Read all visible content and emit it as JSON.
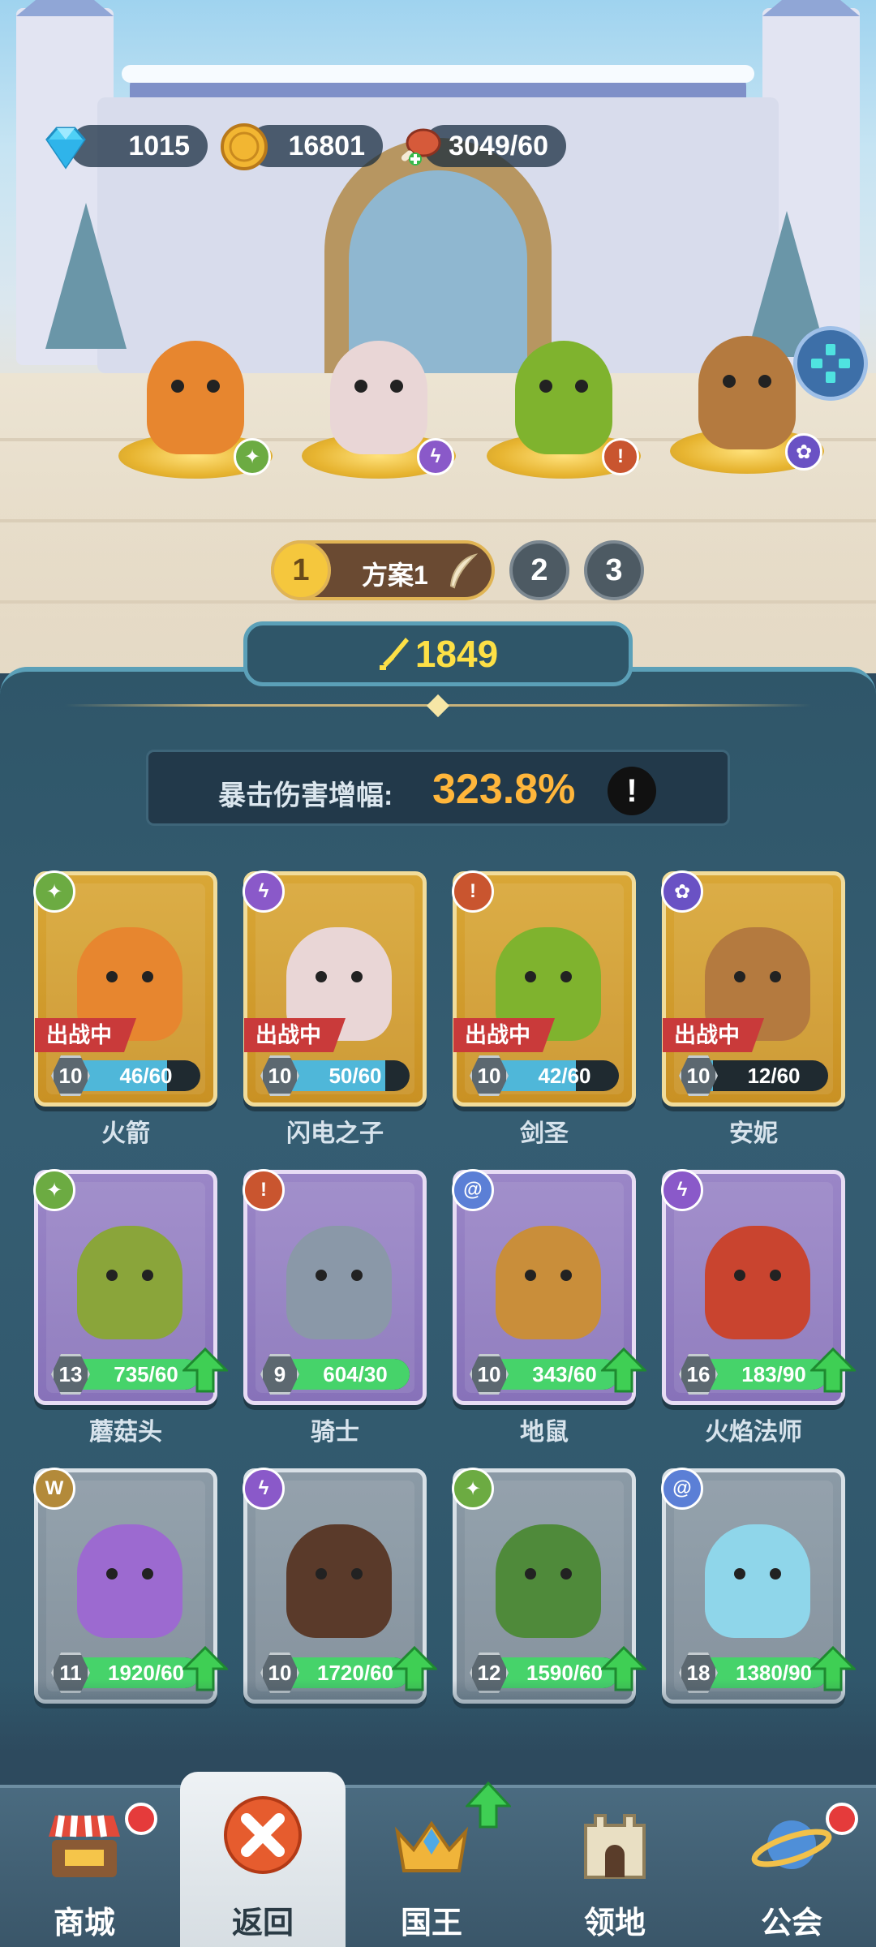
{
  "currency": {
    "gems": "1015",
    "coins": "16801",
    "stamina": "3049/60"
  },
  "icons": {
    "gem": "diamond-icon",
    "coin": "gold-coin-icon",
    "stamina": "meat-icon",
    "gamepad": "gamepad-icon",
    "power": "sword-icon"
  },
  "stage_heroes": [
    {
      "name": "火箭",
      "class_color": "#6cab42"
    },
    {
      "name": "闪电之子",
      "class_color": "#8a59c9"
    },
    {
      "name": "剑圣",
      "class_color": "#c9552f"
    },
    {
      "name": "安妮",
      "class_color": "#6a52c4"
    }
  ],
  "plans": {
    "active_number": "1",
    "active_label": "方案1",
    "others": [
      "2",
      "3"
    ]
  },
  "power": "1849",
  "crit": {
    "label": "暴击伤害增幅:",
    "value": "323.8%",
    "info": "!"
  },
  "heroes": [
    {
      "name": "火箭",
      "level": "10",
      "progress": "46/60",
      "fill": 0.77,
      "tag": "出战中",
      "rarity": "gold",
      "class_icon": "ranger-icon",
      "badge_color": "#6cab42"
    },
    {
      "name": "闪电之子",
      "level": "10",
      "progress": "50/60",
      "fill": 0.83,
      "tag": "出战中",
      "rarity": "gold",
      "class_icon": "mage-icon",
      "badge_color": "#8a59c9"
    },
    {
      "name": "剑圣",
      "level": "10",
      "progress": "42/60",
      "fill": 0.7,
      "tag": "出战中",
      "rarity": "gold",
      "class_icon": "warrior-icon",
      "badge_color": "#c9552f"
    },
    {
      "name": "安妮",
      "level": "10",
      "progress": "12/60",
      "fill": 0.2,
      "tag": "出战中",
      "rarity": "gold",
      "class_icon": "paw-icon",
      "badge_color": "#6a52c4"
    },
    {
      "name": "蘑菇头",
      "level": "13",
      "progress": "735/60",
      "fill": 1,
      "tag": "",
      "rarity": "purple",
      "class_icon": "ranger-icon",
      "badge_color": "#6cab42",
      "upgrade": true
    },
    {
      "name": "骑士",
      "level": "9",
      "progress": "604/30",
      "fill": 1,
      "tag": "",
      "rarity": "purple",
      "class_icon": "warrior-icon",
      "badge_color": "#c9552f",
      "upgrade": false
    },
    {
      "name": "地鼠",
      "level": "10",
      "progress": "343/60",
      "fill": 1,
      "tag": "",
      "rarity": "purple",
      "class_icon": "spiral-icon",
      "badge_color": "#5b7fd6",
      "upgrade": true
    },
    {
      "name": "火焰法师",
      "level": "16",
      "progress": "183/90",
      "fill": 1,
      "tag": "",
      "rarity": "purple",
      "class_icon": "mage-icon",
      "badge_color": "#8a59c9",
      "upgrade": true
    },
    {
      "name": "",
      "level": "11",
      "progress": "1920/60",
      "fill": 1,
      "tag": "",
      "rarity": "gray",
      "class_icon": "wings-icon",
      "badge_color": "#b38a3a",
      "upgrade": true
    },
    {
      "name": "",
      "level": "10",
      "progress": "1720/60",
      "fill": 1,
      "tag": "",
      "rarity": "gray",
      "class_icon": "mage-icon",
      "badge_color": "#8a59c9",
      "upgrade": true
    },
    {
      "name": "",
      "level": "12",
      "progress": "1590/60",
      "fill": 1,
      "tag": "",
      "rarity": "gray",
      "class_icon": "ranger-icon",
      "badge_color": "#6cab42",
      "upgrade": true
    },
    {
      "name": "",
      "level": "18",
      "progress": "1380/90",
      "fill": 1,
      "tag": "",
      "rarity": "gray",
      "class_icon": "spiral-icon",
      "badge_color": "#5b7fd6",
      "upgrade": true
    }
  ],
  "nav": [
    {
      "label": "商城",
      "icon": "shop-icon",
      "notify": true
    },
    {
      "label": "返回",
      "icon": "close-icon",
      "notify": false,
      "active": true
    },
    {
      "label": "国王",
      "icon": "crown-icon",
      "notify": false,
      "upgrade": true
    },
    {
      "label": "领地",
      "icon": "castle-icon",
      "notify": false
    },
    {
      "label": "公会",
      "icon": "planet-icon",
      "notify": true
    }
  ]
}
